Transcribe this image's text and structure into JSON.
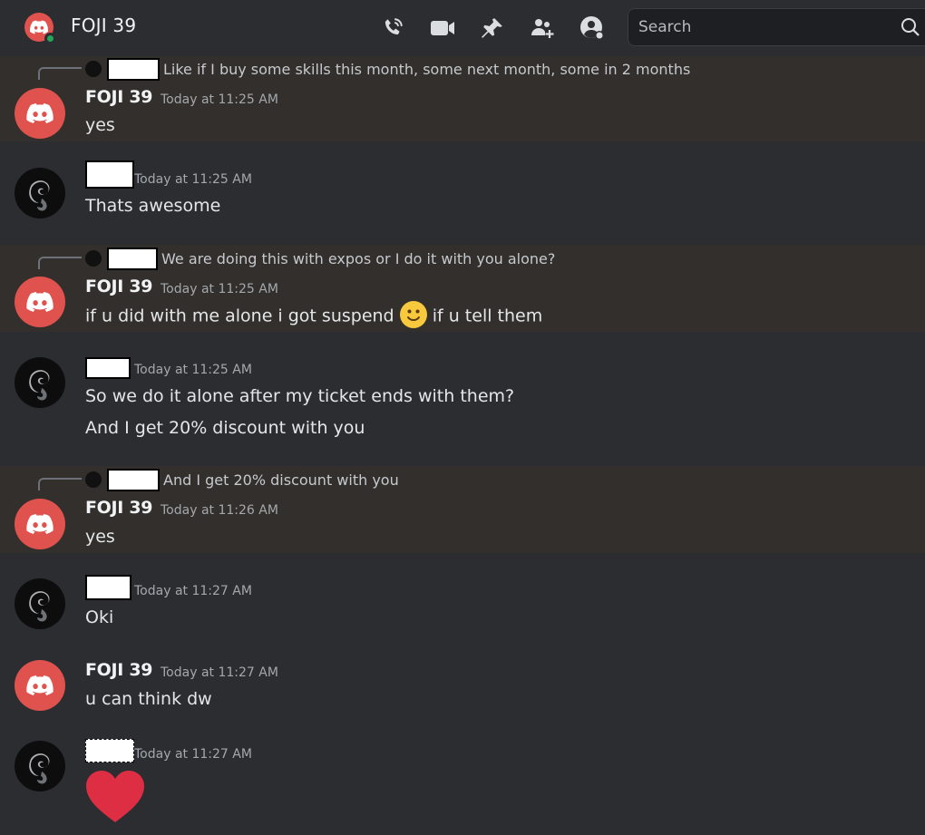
{
  "header": {
    "title": "FOJI 39",
    "search_placeholder": "Search",
    "icons": [
      "voice-call-icon",
      "video-call-icon",
      "pinned-messages-icon",
      "add-friends-icon",
      "user-profile-icon",
      "search-icon"
    ],
    "status_color": "#23a55a",
    "avatar_color": "#e0524e"
  },
  "messages": [
    {
      "reply_text": "Like if I buy some skills this month, some next month, some in 2 months",
      "author": "FOJI 39",
      "time": "Today at 11:25 AM",
      "lines": [
        "yes"
      ]
    },
    {
      "author": "",
      "time": "Today at 11:25 AM",
      "lines": [
        "Thats awesome"
      ]
    },
    {
      "reply_text": "We are doing this with expos or I do it with you alone?",
      "author": "FOJI 39",
      "time": "Today at 11:25 AM",
      "lines": [
        "if u did with me alone i got suspend",
        "if u tell them"
      ],
      "emoji": "slightly-smiling-face"
    },
    {
      "author": "",
      "time": "Today at 11:25 AM",
      "lines": [
        "So we do it alone after my ticket ends with them?",
        "And I get 20% discount with you"
      ]
    },
    {
      "reply_text": "And I get 20% discount with you",
      "author": "FOJI 39",
      "time": "Today at 11:26 AM",
      "lines": [
        "yes"
      ]
    },
    {
      "author": "",
      "time": "Today at 11:27 AM",
      "lines": [
        "Oki"
      ]
    },
    {
      "author": "FOJI 39",
      "time": "Today at 11:27 AM",
      "lines": [
        "u can think dw"
      ]
    },
    {
      "author": "",
      "time": "Today at 11:27 AM",
      "lines": [],
      "emoji": "red-heart"
    }
  ]
}
